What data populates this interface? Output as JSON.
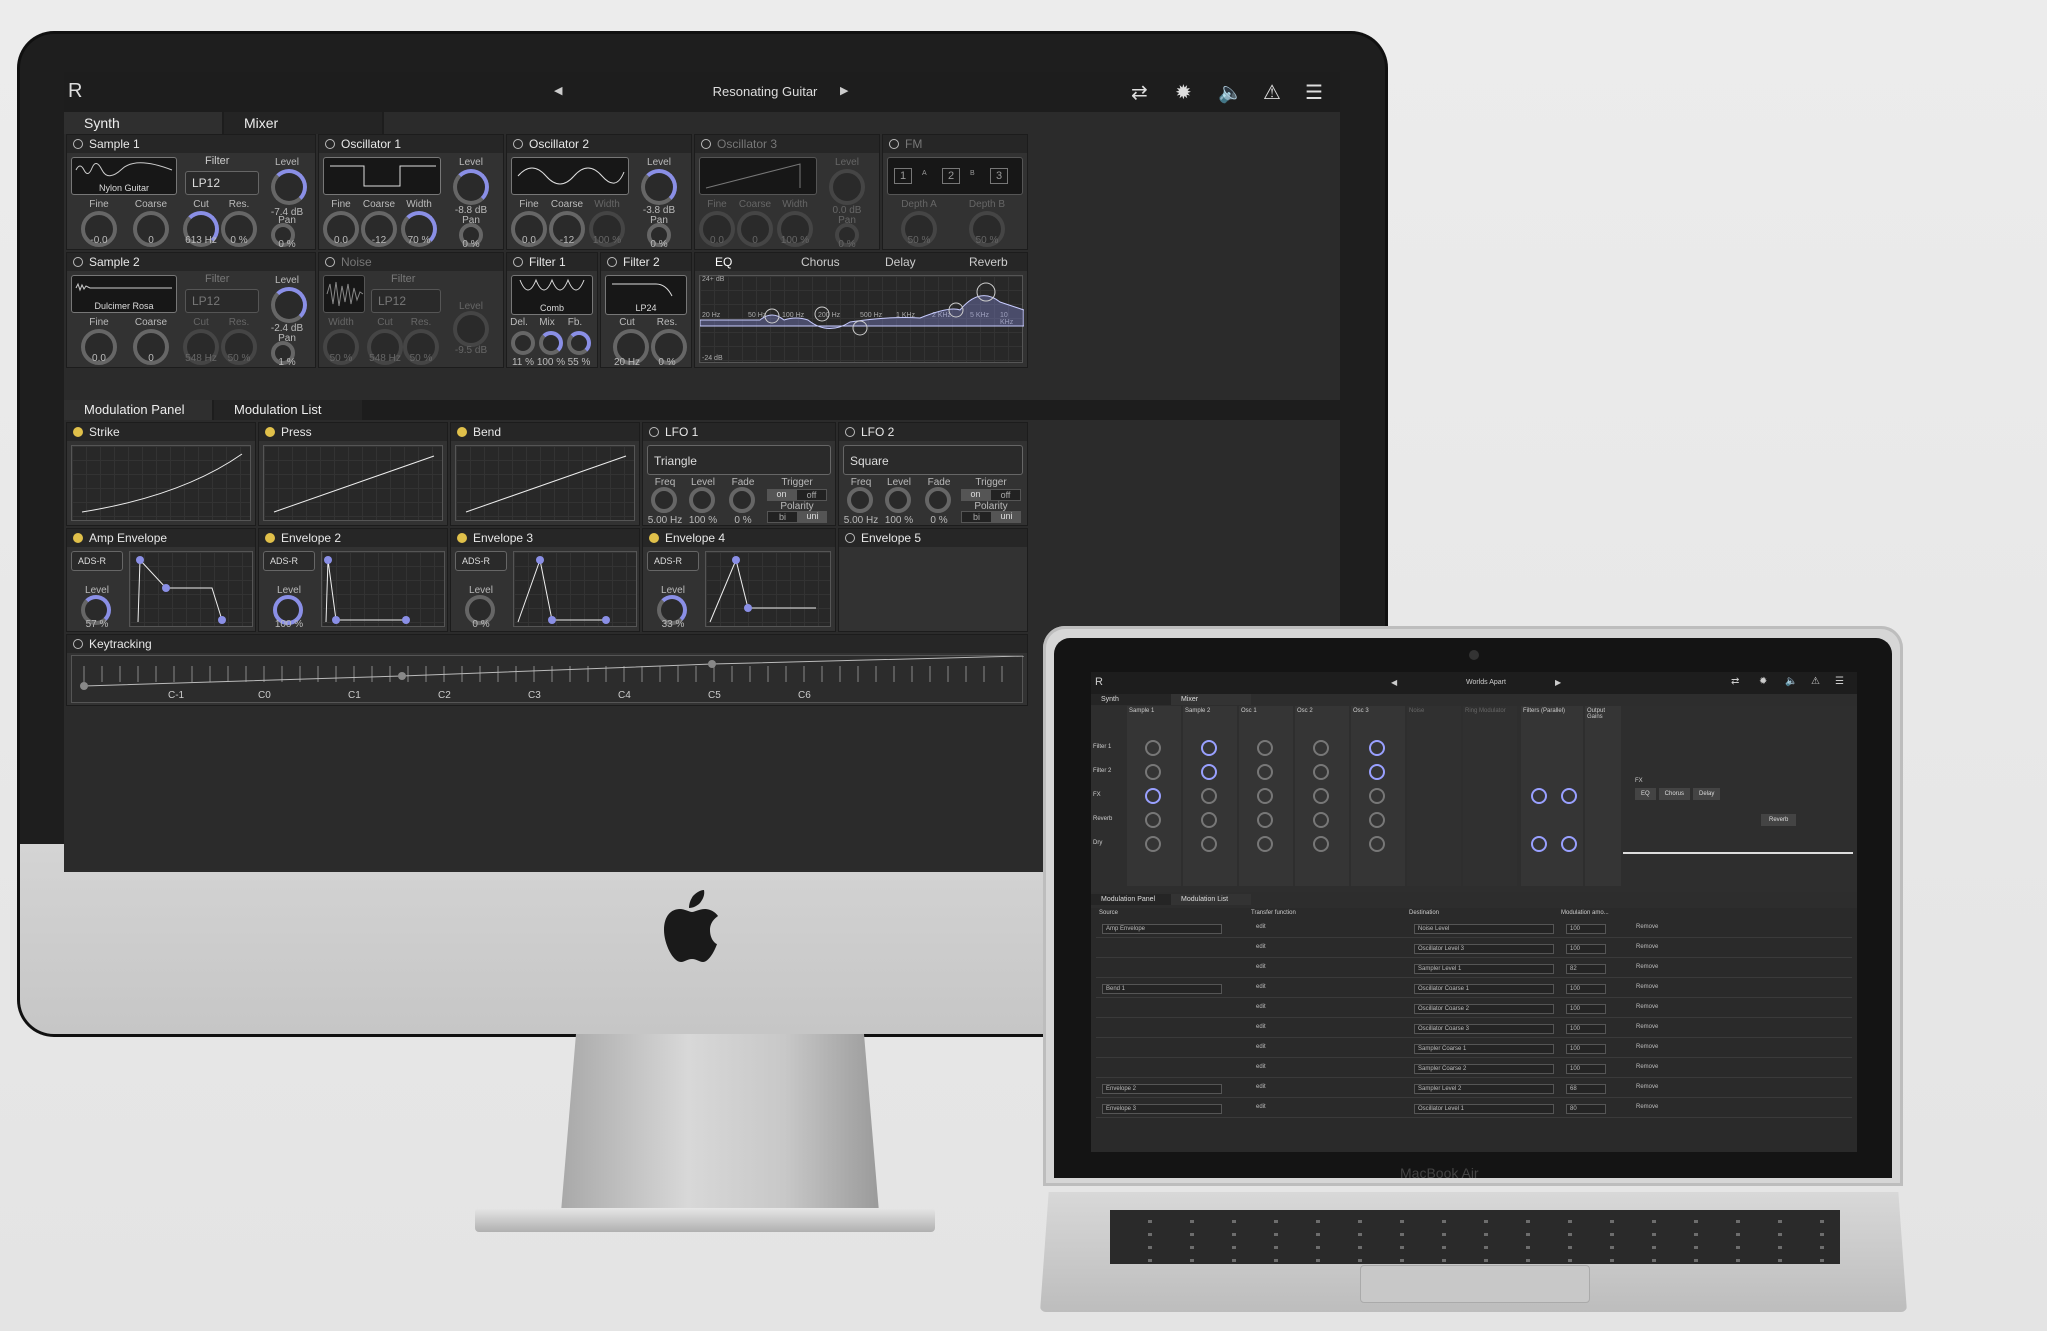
{
  "app": {
    "preset_name": "Resonating Guitar",
    "prev_arrow": "◀",
    "next_arrow": "▶",
    "tabs": [
      "Synth",
      "Mixer"
    ],
    "mod_tabs": [
      "Modulation Panel",
      "Modulation List"
    ]
  },
  "sample1": {
    "title": "Sample 1",
    "sample": "Nylon Guitar",
    "filter_label": "Filter",
    "filter_type": "LP12",
    "level_label": "Level",
    "level": "-7.4 dB",
    "fine_label": "Fine",
    "fine": "-0.0",
    "coarse_label": "Coarse",
    "coarse": "0",
    "cut_label": "Cut",
    "cut": "613 Hz",
    "res_label": "Res.",
    "res": "0 %",
    "pan_label": "Pan",
    "pan": "0 %"
  },
  "osc1": {
    "title": "Oscillator 1",
    "level_label": "Level",
    "level": "-8.8 dB",
    "fine_label": "Fine",
    "fine": "0.0",
    "coarse_label": "Coarse",
    "coarse": "-12",
    "width_label": "Width",
    "width": "70 %",
    "pan_label": "Pan",
    "pan": "0 %"
  },
  "osc2": {
    "title": "Oscillator 2",
    "level_label": "Level",
    "level": "-3.8 dB",
    "fine_label": "Fine",
    "fine": "0.0",
    "coarse_label": "Coarse",
    "coarse": "-12",
    "width_label": "Width",
    "width": "100 %",
    "pan_label": "Pan",
    "pan": "0 %"
  },
  "osc3": {
    "title": "Oscillator 3",
    "level_label": "Level",
    "level": "0.0 dB",
    "fine_label": "Fine",
    "fine": "0.0",
    "coarse_label": "Coarse",
    "coarse": "0",
    "width_label": "Width",
    "width": "100 %",
    "pan_label": "Pan",
    "pan": "0 %"
  },
  "fm": {
    "title": "FM",
    "n1": "1",
    "n2": "2",
    "n3": "3",
    "a": "A",
    "b": "B",
    "depth_a_label": "Depth A",
    "depth_a": "50 %",
    "depth_b_label": "Depth B",
    "depth_b": "50 %"
  },
  "sample2": {
    "title": "Sample 2",
    "sample": "Dulcimer Rosa",
    "filter_label": "Filter",
    "filter_type": "LP12",
    "level_label": "Level",
    "level": "-2.4 dB",
    "fine_label": "Fine",
    "fine": "0.0",
    "coarse_label": "Coarse",
    "coarse": "0",
    "cut_label": "Cut",
    "cut": "548 Hz",
    "res_label": "Res.",
    "res": "50 %",
    "pan_label": "Pan",
    "pan": "1 %"
  },
  "noise": {
    "title": "Noise",
    "filter_label": "Filter",
    "filter_type": "LP12",
    "level_label": "Level",
    "level": "-9.5 dB",
    "width_label": "Width",
    "width": "50 %",
    "cut_label": "Cut",
    "cut": "548 Hz",
    "res_label": "Res.",
    "res": "50 %"
  },
  "filter1": {
    "title": "Filter 1",
    "type": "Comb",
    "del_label": "Del.",
    "del": "11 %",
    "mix_label": "Mix",
    "mix": "100 %",
    "fb_label": "Fb.",
    "fb": "55 %"
  },
  "filter2": {
    "title": "Filter 2",
    "type": "LP24",
    "cut_label": "Cut",
    "cut": "20 Hz",
    "res_label": "Res.",
    "res": "0 %"
  },
  "fx": {
    "tabs": [
      "EQ",
      "Chorus",
      "Delay",
      "Reverb"
    ],
    "top_db": "24+ dB",
    "bottom_db": "-24 dB",
    "freqs": [
      "20 Hz",
      "50 Hz",
      "100 Hz",
      "200 Hz",
      "500 Hz",
      "1 KHz",
      "2 KHz",
      "5 KHz",
      "10 KHz"
    ]
  },
  "mods": {
    "strike": "Strike",
    "press": "Press",
    "bend": "Bend",
    "lfo1": {
      "title": "LFO 1",
      "shape": "Triangle",
      "freq_label": "Freq",
      "freq": "5.00 Hz",
      "level_label": "Level",
      "level": "100 %",
      "fade_label": "Fade",
      "fade": "0 %",
      "trigger_label": "Trigger",
      "on": "on",
      "off": "off",
      "polarity_label": "Polarity",
      "bi": "bi",
      "uni": "uni"
    },
    "lfo2": {
      "title": "LFO 2",
      "shape": "Square",
      "freq_label": "Freq",
      "freq": "5.00 Hz",
      "level_label": "Level",
      "level": "100 %",
      "fade_label": "Fade",
      "fade": "0 %",
      "trigger_label": "Trigger",
      "on": "on",
      "off": "off",
      "polarity_label": "Polarity",
      "bi": "bi",
      "uni": "uni"
    },
    "amp_env": {
      "title": "Amp Envelope",
      "mode": "ADS-R",
      "level_label": "Level",
      "level": "57 %"
    },
    "env2": {
      "title": "Envelope 2",
      "mode": "ADS-R",
      "level_label": "Level",
      "level": "100 %"
    },
    "env3": {
      "title": "Envelope 3",
      "mode": "ADS-R",
      "level_label": "Level",
      "level": "0 %"
    },
    "env4": {
      "title": "Envelope 4",
      "mode": "ADS-R",
      "level_label": "Level",
      "level": "33 %"
    },
    "env5": {
      "title": "Envelope 5"
    },
    "keytracking": {
      "title": "Keytracking",
      "notes": [
        "C-1",
        "C0",
        "C1",
        "C2",
        "C3",
        "C4",
        "C5",
        "C6"
      ]
    }
  },
  "macbook": {
    "label": "MacBook Air",
    "preset_name": "Worlds Apart",
    "tabs": [
      "Synth",
      "Mixer"
    ],
    "columns": [
      "Sample 1",
      "Sample 2",
      "Osc 1",
      "Osc 2",
      "Osc 3",
      "Noise",
      "Ring Modulator",
      "Filters (Parallel)",
      "Output Gains"
    ],
    "rows": [
      "Filter 1",
      "Filter 2",
      "FX",
      "Reverb",
      "Dry"
    ],
    "fx_chain": [
      "EQ",
      "Chorus",
      "Delay"
    ],
    "reverb": "Reverb",
    "fx_label": "FX",
    "mod_tabs": [
      "Modulation Panel",
      "Modulation List"
    ],
    "list_headers": [
      "Source",
      "Transfer function",
      "Destination",
      "Modulation amo..."
    ],
    "list_rows": [
      {
        "source": "Amp Envelope",
        "edit": "edit",
        "dest": "Noise Level",
        "amount": "100",
        "remove": "Remove"
      },
      {
        "source": "",
        "edit": "edit",
        "dest": "Oscillator Level 3",
        "amount": "100",
        "remove": "Remove"
      },
      {
        "source": "",
        "edit": "edit",
        "dest": "Sampler Level 1",
        "amount": "82",
        "remove": "Remove"
      },
      {
        "source": "Bend 1",
        "edit": "edit",
        "dest": "Oscillator Coarse 1",
        "amount": "100",
        "remove": "Remove"
      },
      {
        "source": "",
        "edit": "edit",
        "dest": "Oscillator Coarse 2",
        "amount": "100",
        "remove": "Remove"
      },
      {
        "source": "",
        "edit": "edit",
        "dest": "Oscillator Coarse 3",
        "amount": "100",
        "remove": "Remove"
      },
      {
        "source": "",
        "edit": "edit",
        "dest": "Sampler Coarse 1",
        "amount": "100",
        "remove": "Remove"
      },
      {
        "source": "",
        "edit": "edit",
        "dest": "Sampler Coarse 2",
        "amount": "100",
        "remove": "Remove"
      },
      {
        "source": "Envelope 2",
        "edit": "edit",
        "dest": "Sampler Level 2",
        "amount": "68",
        "remove": "Remove"
      },
      {
        "source": "Envelope 3",
        "edit": "edit",
        "dest": "Oscillator Level 1",
        "amount": "80",
        "remove": "Remove"
      }
    ]
  },
  "colors": {
    "accent": "#8a8fe6",
    "mod_dot": "#e0c04a",
    "panel": "#323232"
  }
}
